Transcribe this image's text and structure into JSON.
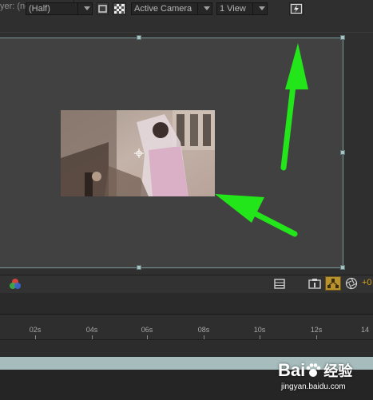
{
  "panel": {
    "layer_label": "yer: (none)"
  },
  "toolbar": {
    "resolution_value": "(Half)",
    "camera_value": "Active Camera",
    "view_layout_value": "1 View",
    "exposure_value": "+0"
  },
  "timeline": {
    "ticks": [
      "02s",
      "04s",
      "06s",
      "08s",
      "10s",
      "12s",
      "14"
    ]
  },
  "watermark": {
    "brand": "Bai",
    "brand_cn": "经验",
    "site": "jingyan.baidu.com"
  },
  "colors": {
    "annotation_arrow": "#22e619",
    "comp_bounds": "#7d9a9a",
    "work_area": "#a7bdbd",
    "exposure_text": "#d4a017"
  },
  "icons": [
    "color-channels-icon",
    "region-of-interest-icon",
    "transparency-grid-icon",
    "grid-guides-icon",
    "fast-previews-icon",
    "snapshot-icon",
    "flowchart-icon",
    "shutter-icon"
  ]
}
